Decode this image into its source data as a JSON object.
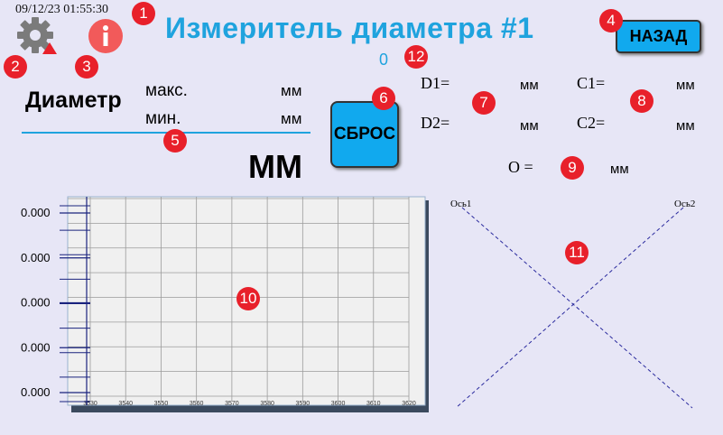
{
  "header": {
    "datetime": "09/12/23 01:55:30",
    "title": "Измеритель диаметра #1",
    "counter": "0",
    "back_label": "НАЗАД"
  },
  "diameter": {
    "label": "Диаметр",
    "max_label": "макс.",
    "min_label": "мин.",
    "max_unit": "мм",
    "min_unit": "мм",
    "big_unit": "ММ"
  },
  "reset_label": "СБРОС",
  "params": {
    "d1_label": "D1=",
    "d1_unit": "мм",
    "d2_label": "D2=",
    "d2_unit": "мм",
    "c1_label": "C1=",
    "c1_unit": "мм",
    "c2_label": "C2=",
    "c2_unit": "мм",
    "o_label": "O =",
    "o_unit": "мм"
  },
  "axes": {
    "axis1_label": "Ось1",
    "axis2_label": "Ось2"
  },
  "badges": [
    "1",
    "2",
    "3",
    "4",
    "5",
    "6",
    "7",
    "8",
    "9",
    "10",
    "11",
    "12"
  ],
  "icons": {
    "settings": "gear-icon",
    "warning": "warning-triangle-icon",
    "info": "info-icon"
  },
  "colors": {
    "accent": "#1fa3de",
    "button": "#11a9ee",
    "badge": "#e8202a",
    "background": "#e7e6f6"
  },
  "chart_data": {
    "type": "line",
    "x_ticks": [
      "3530",
      "3540",
      "3550",
      "3560",
      "3570",
      "3580",
      "3590",
      "3600",
      "3610",
      "3620"
    ],
    "y_ticks": [
      "0.000",
      "0.000",
      "0.000",
      "0.000",
      "0.000"
    ],
    "xlim": [
      3530,
      3620
    ],
    "grid": true,
    "series": []
  }
}
